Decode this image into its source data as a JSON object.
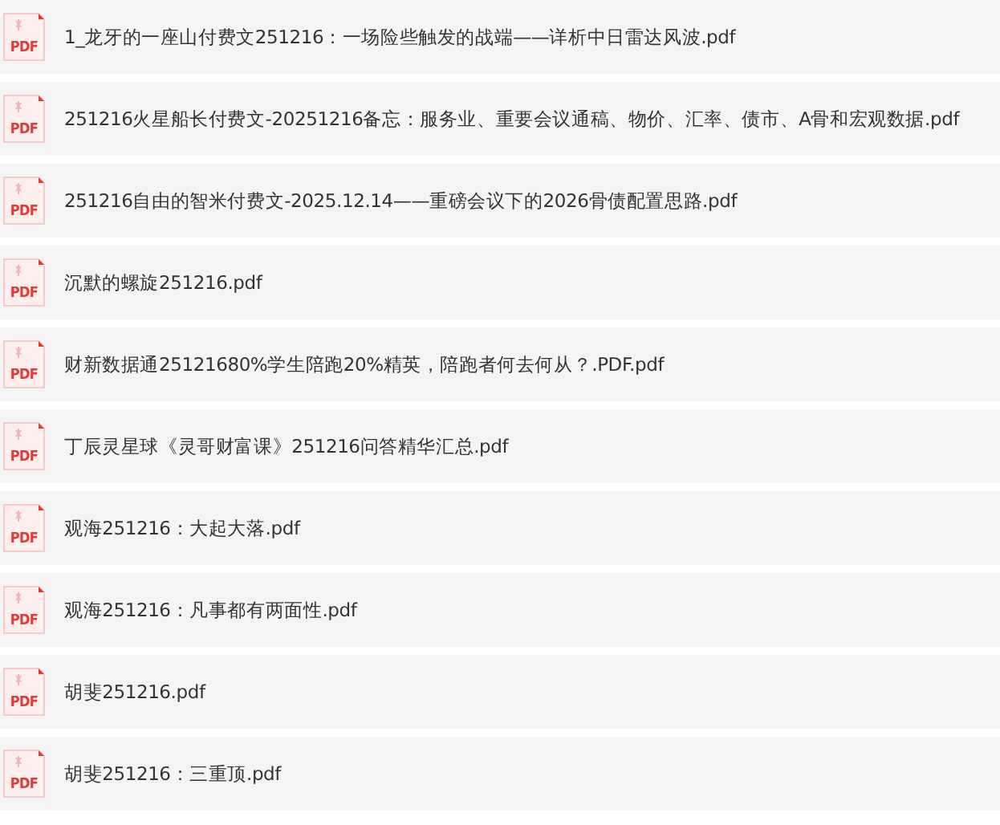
{
  "files": [
    {
      "icon_label": "PDF",
      "name": "1_龙牙的一座山付费文251216：一场险些触发的战端——详析中日雷达风波.pdf"
    },
    {
      "icon_label": "PDF",
      "name": "251216火星船长付费文-20251216备忘：服务业、重要会议通稿、物价、汇率、债市、A骨和宏观数据.pdf"
    },
    {
      "icon_label": "PDF",
      "name": "251216自由的智米付费文-2025.12.14——重磅会议下的2026骨债配置思路.pdf"
    },
    {
      "icon_label": "PDF",
      "name": "沉默的螺旋251216.pdf"
    },
    {
      "icon_label": "PDF",
      "name": "财新数据通25121680%学生陪跑20%精英，陪跑者何去何从？.PDF.pdf"
    },
    {
      "icon_label": "PDF",
      "name": "丁辰灵星球《灵哥财富课》251216问答精华汇总.pdf"
    },
    {
      "icon_label": "PDF",
      "name": "观海251216：大起大落.pdf"
    },
    {
      "icon_label": "PDF",
      "name": "观海251216：凡事都有两面性.pdf"
    },
    {
      "icon_label": "PDF",
      "name": "胡斐251216.pdf"
    },
    {
      "icon_label": "PDF",
      "name": "胡斐251216：三重顶.pdf"
    }
  ]
}
